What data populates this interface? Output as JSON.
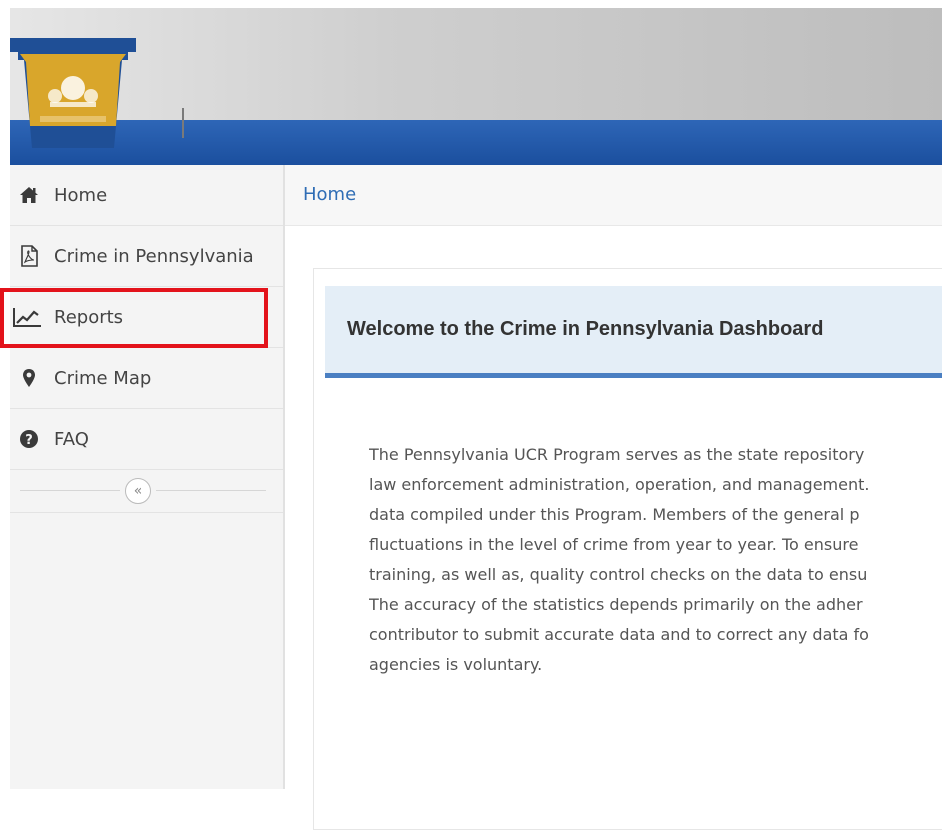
{
  "sidebar": {
    "items": [
      {
        "label": "Home",
        "icon": "home-icon"
      },
      {
        "label": "Crime in Pennsylvania",
        "icon": "pdf-file-icon"
      },
      {
        "label": "Reports",
        "icon": "line-chart-icon"
      },
      {
        "label": "Crime Map",
        "icon": "map-marker-icon"
      },
      {
        "label": "FAQ",
        "icon": "question-circle-icon"
      }
    ],
    "collapse_glyph": "«"
  },
  "breadcrumb": {
    "label": "Home"
  },
  "welcome": {
    "title": "Welcome to the Crime in Pennsylvania Dashboard",
    "body_lines": [
      "The Pennsylvania UCR Program serves as the state repository",
      "law enforcement administration, operation, and management.",
      "data compiled under this Program. Members of the general p",
      "fluctuations in the level of crime from year to year. To ensure",
      "training, as well as, quality control checks on the data to ensu",
      "The accuracy of the statistics depends primarily on the adher",
      "contributor to submit accurate data and to correct any data fo",
      "agencies is voluntary."
    ]
  },
  "colors": {
    "header_band": "#1b4f9e",
    "keystone_gold": "#d9a62b",
    "keystone_blue": "#1f4f96",
    "link": "#2f6db5",
    "highlight": "#e3131b",
    "card_header_bg": "#e4eef7",
    "card_header_border": "#4a7fc2"
  }
}
